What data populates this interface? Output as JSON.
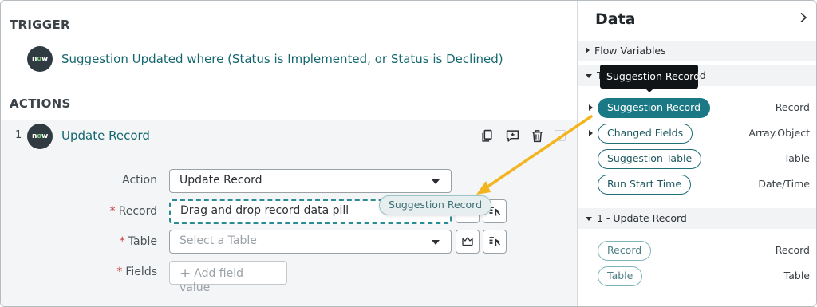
{
  "trigger": {
    "section_title": "TRIGGER",
    "badge_text": "now",
    "description": "Suggestion Updated where (Status is Implemented, or Status is Declined)"
  },
  "actions": {
    "section_title": "ACTIONS",
    "step_number": "1",
    "badge_text": "now",
    "step_title": "Update Record",
    "toolbar_icons": [
      "copy-icon",
      "add-comment-icon",
      "trash-icon"
    ]
  },
  "form": {
    "action_label": "Action",
    "action_value": "Update Record",
    "record_label": "Record",
    "record_placeholder": "Drag and drop record data pill",
    "table_label": "Table",
    "table_placeholder": "Select a Table",
    "fields_label": "Fields",
    "add_field_label": "Add field value",
    "required_mark": "*"
  },
  "dragging_pill": "Suggestion Record",
  "data_panel": {
    "title": "Data",
    "tooltip": "Suggestion Record",
    "groups": [
      {
        "label": "Flow Variables",
        "expanded": false
      },
      {
        "label": "Trigger - Record Updated",
        "visible_label": "T",
        "visible_suffix": "ated",
        "expanded": true,
        "items": [
          {
            "label": "Suggestion Record",
            "type": "Record",
            "active": true,
            "expandable": true
          },
          {
            "label": "Changed Fields",
            "type": "Array.Object",
            "expandable": true
          },
          {
            "label": "Suggestion Table",
            "type": "Table"
          },
          {
            "label": "Run Start Time",
            "type": "Date/Time"
          }
        ]
      },
      {
        "label": "1 - Update Record",
        "expanded": true,
        "items": [
          {
            "label": "Record",
            "type": "Record"
          },
          {
            "label": "Table",
            "type": "Table"
          }
        ]
      }
    ]
  },
  "colors": {
    "accent": "#1a7985",
    "link": "#15676f",
    "arrow": "#f2b51f",
    "required": "#c93b3b"
  }
}
